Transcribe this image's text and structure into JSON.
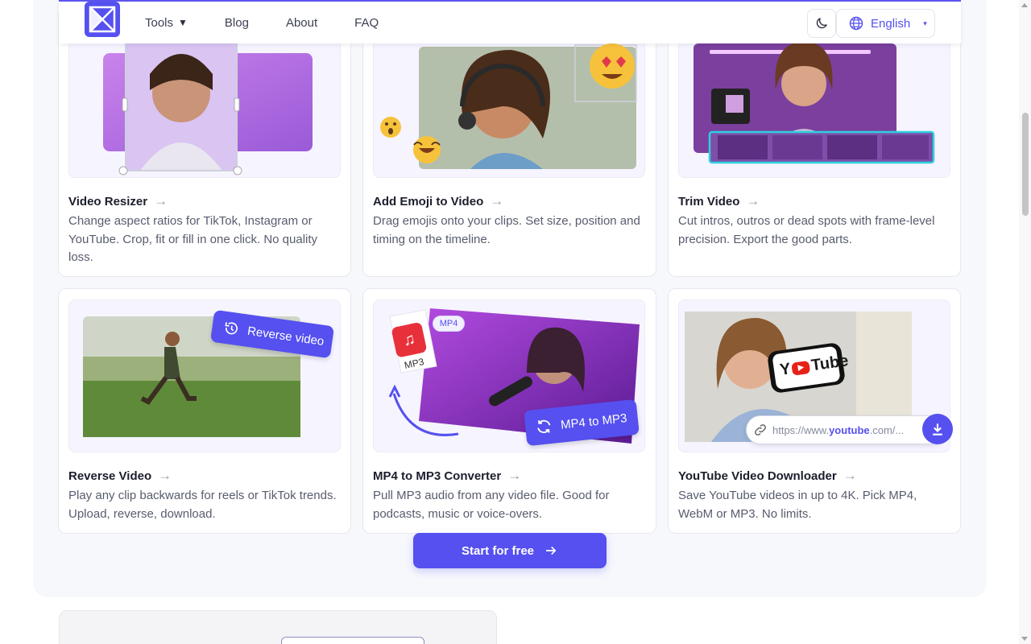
{
  "nav": {
    "links": [
      {
        "label": "Tools",
        "caret": "▼"
      },
      {
        "label": "Blog"
      },
      {
        "label": "About"
      },
      {
        "label": "FAQ"
      }
    ],
    "language": "English",
    "language_caret": "▾"
  },
  "cards": [
    {
      "title": "Video Resizer",
      "description": "Change aspect ratios for TikTok, Instagram or YouTube. Crop, fit or fill in one click. No quality loss.",
      "icon": "crop-frame"
    },
    {
      "title": "Add Emoji to Video",
      "description": "Drag emojis onto your clips. Set size, position and timing on the timeline.",
      "icon": "emoji"
    },
    {
      "title": "Trim Video",
      "description": "Cut intros, outros or dead spots with frame-level precision. Export the good parts.",
      "icon": "timeline"
    },
    {
      "title": "Reverse Video",
      "description": "Play any clip backwards for reels or TikTok trends. Upload, reverse, download.",
      "badge": "Reverse video",
      "icon": "history"
    },
    {
      "title": "MP4 to MP3 Converter",
      "description": "Pull MP3 audio from any video file. Good for podcasts, music or voice-overs.",
      "tag": "MP4",
      "file_label": "MP3",
      "badge": "MP4 to MP3",
      "icon": "music-file"
    },
    {
      "title": "YouTube Video Downloader",
      "description": "Save YouTube videos in up to 4K. Pick MP4, WebM or MP3. No limits.",
      "logo_y": "Y",
      "logo_tube": "Tube",
      "url_prefix": "https://www.",
      "url_domain": "youtube",
      "url_suffix": ".com/...",
      "icon": "download"
    }
  ],
  "arrow": "→",
  "cta": {
    "label": "Start for free"
  },
  "colors": {
    "accent": "#5550ef",
    "panel_bg": "#f7f8fc",
    "text_muted": "#585c6e"
  }
}
